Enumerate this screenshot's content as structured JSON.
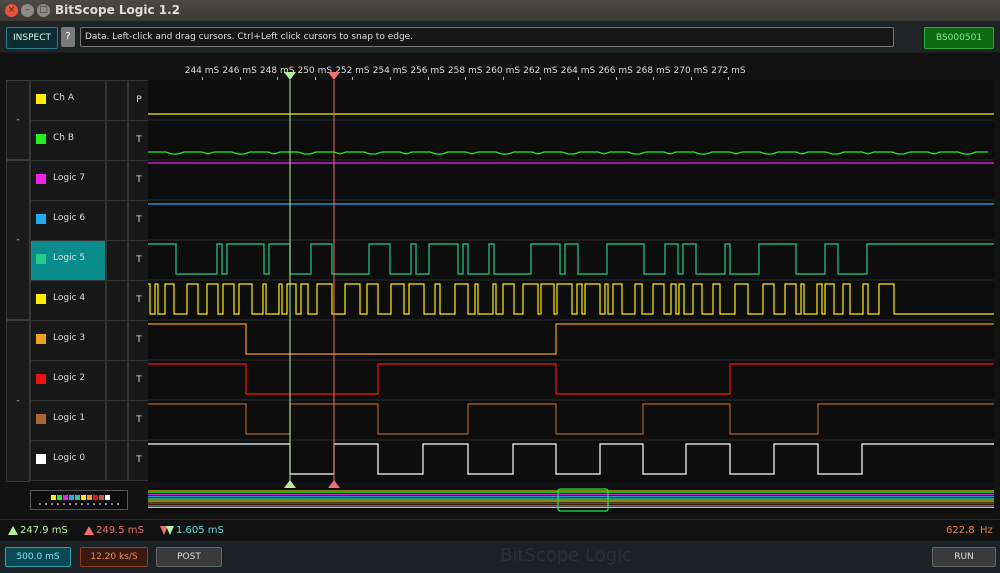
{
  "window": {
    "title": "BitScope Logic 1.2",
    "close_glyph": "×",
    "min_glyph": "–",
    "max_glyph": "□"
  },
  "toolbar": {
    "inspect_label": "INSPECT",
    "help_label": "?",
    "message": "Data. Left-click and drag cursors. Ctrl+Left click cursors to snap to edge.",
    "device_label": "BS000501"
  },
  "axis": {
    "ticks": [
      "244 mS",
      "246 mS",
      "248 mS",
      "250 mS",
      "252 mS",
      "254 mS",
      "256 mS",
      "258 mS",
      "260 mS",
      "262 mS",
      "264 mS",
      "266 mS",
      "268 mS",
      "270 mS",
      "272 mS"
    ]
  },
  "groups": [
    "-",
    "-",
    "-"
  ],
  "channels": [
    {
      "name": "Ch A",
      "color": "#ffee00",
      "trigger": "P"
    },
    {
      "name": "Ch B",
      "color": "#22ee22",
      "trigger": "T"
    },
    {
      "name": "Logic 7",
      "color": "#ee22ee",
      "trigger": "T"
    },
    {
      "name": "Logic 6",
      "color": "#22aaee",
      "trigger": "T"
    },
    {
      "name": "Logic 5",
      "color": "#22cc88",
      "trigger": "T",
      "selected": true
    },
    {
      "name": "Logic 4",
      "color": "#ffee00",
      "trigger": "T"
    },
    {
      "name": "Logic 3",
      "color": "#f0a020",
      "trigger": "T"
    },
    {
      "name": "Logic 2",
      "color": "#ee1111",
      "trigger": "T"
    },
    {
      "name": "Logic 1",
      "color": "#aa6633",
      "trigger": "T"
    },
    {
      "name": "Logic 0",
      "color": "#ffffff",
      "trigger": "T"
    }
  ],
  "cursors": {
    "a": "247.9 mS",
    "b": "249.5 mS",
    "delta": "1.605 mS",
    "frequency": "622.8",
    "frequency_unit": "Hz"
  },
  "bottom": {
    "timebase": "500.0 mS",
    "sample_rate": "12.20 ks/S",
    "post_label": "POST",
    "brand": "BitScope Logic",
    "run_label": "RUN"
  }
}
